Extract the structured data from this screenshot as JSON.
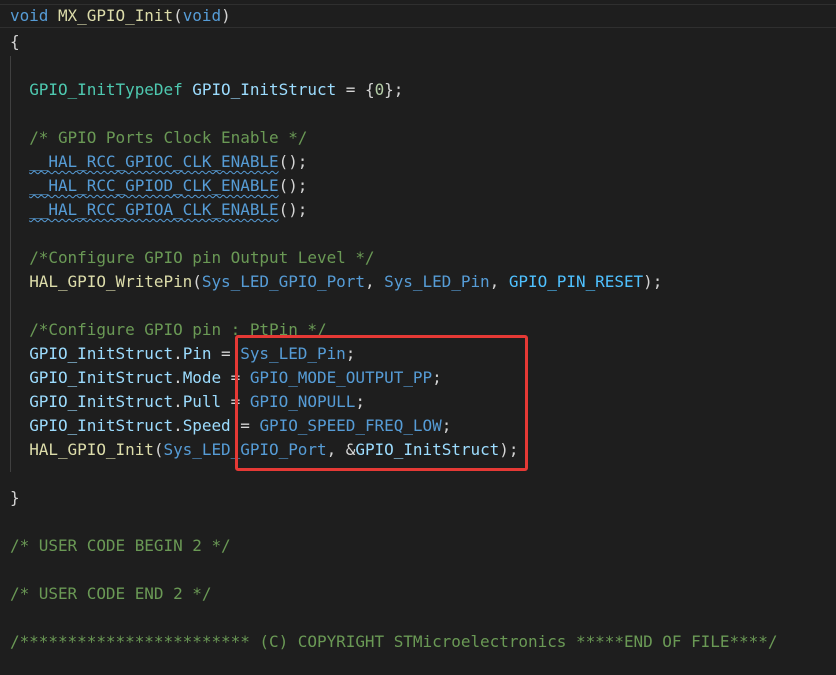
{
  "editor": {
    "lines": {
      "l1": {
        "kw": "void",
        "fn": "MX_GPIO_Init",
        "open": "(",
        "arg": "void",
        "close": ")"
      },
      "l2": {
        "text": "{"
      },
      "l4": {
        "type": "GPIO_InitTypeDef",
        "var": "GPIO_InitStruct",
        "eq": " = {",
        "num": "0",
        "end": "};"
      },
      "l6": {
        "comment": "/* GPIO Ports Clock Enable */"
      },
      "l7": {
        "macro": "__HAL_RCC_GPIOC_CLK_ENABLE",
        "end": "();"
      },
      "l8": {
        "macro": "__HAL_RCC_GPIOD_CLK_ENABLE",
        "end": "();"
      },
      "l9": {
        "macro": "__HAL_RCC_GPIOA_CLK_ENABLE",
        "end": "();"
      },
      "l11": {
        "comment": "/*Configure GPIO pin Output Level */"
      },
      "l12": {
        "fn": "HAL_GPIO_WritePin",
        "open": "(",
        "a1": "Sys_LED_GPIO_Port",
        "c1": ", ",
        "a2": "Sys_LED_Pin",
        "c2": ", ",
        "a3": "GPIO_PIN_RESET",
        "end": ");"
      },
      "l14": {
        "comment": "/*Configure GPIO pin : PtPin */"
      },
      "l15": {
        "var": "GPIO_InitStruct",
        "dot": ".",
        "field": "Pin",
        "eq": " = ",
        "val": "Sys_LED_Pin",
        "end": ";"
      },
      "l16": {
        "var": "GPIO_InitStruct",
        "dot": ".",
        "field": "Mode",
        "eq": " = ",
        "val": "GPIO_MODE_OUTPUT_PP",
        "end": ";"
      },
      "l17": {
        "var": "GPIO_InitStruct",
        "dot": ".",
        "field": "Pull",
        "eq": " = ",
        "val": "GPIO_NOPULL",
        "end": ";"
      },
      "l18": {
        "var": "GPIO_InitStruct",
        "dot": ".",
        "field": "Speed",
        "eq": " = ",
        "val": "GPIO_SPEED_FREQ_LOW",
        "end": ";"
      },
      "l19": {
        "fn": "HAL_GPIO_Init",
        "open": "(",
        "a1": "Sys_LED_GPIO_Port",
        "c1": ", &",
        "a2": "GPIO_InitStruct",
        "end": ");"
      },
      "l21": {
        "text": "}"
      },
      "l23": {
        "comment": "/* USER CODE BEGIN 2 */"
      },
      "l25": {
        "comment": "/* USER CODE END 2 */"
      },
      "l27": {
        "comment": "/************************ (C) COPYRIGHT STMicroelectronics *****END OF FILE****/"
      }
    }
  },
  "annotation": {
    "box_color": "#e53935"
  }
}
